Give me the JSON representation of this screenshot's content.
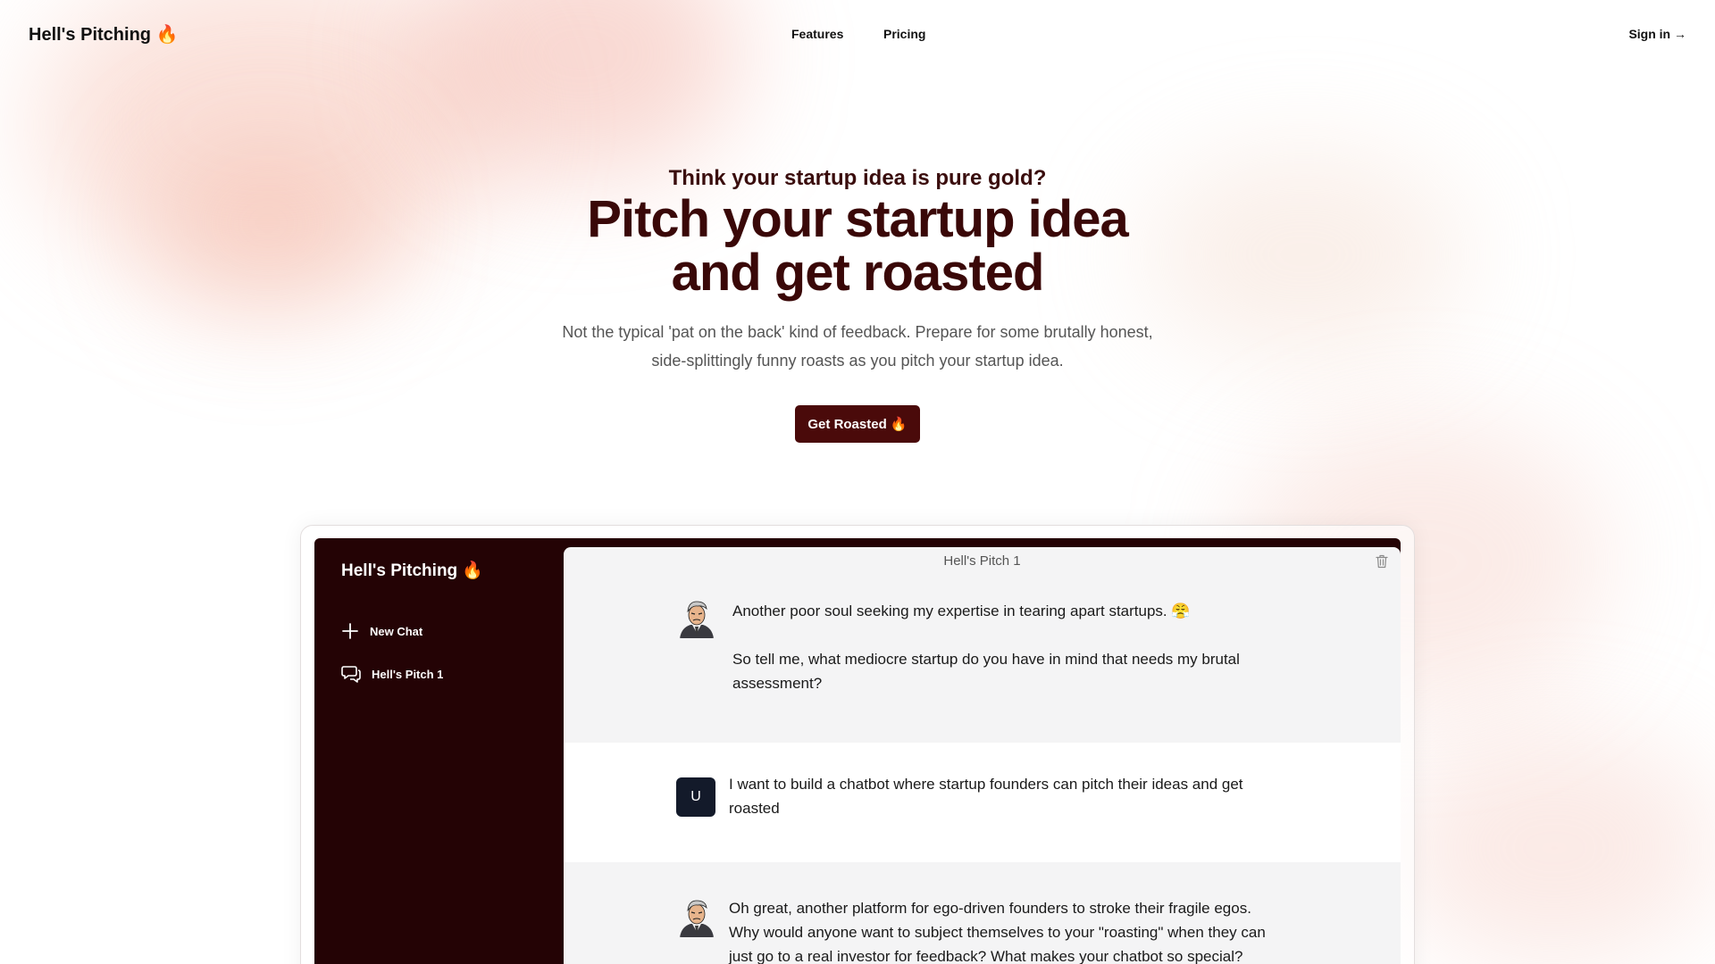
{
  "nav": {
    "brand": "Hell's Pitching 🔥",
    "links": [
      "Features",
      "Pricing"
    ],
    "sign_in": "Sign in →"
  },
  "hero": {
    "eyebrow": "Think your startup idea is pure gold?",
    "headline_line1": "Pitch your startup idea",
    "headline_line2": "and get roasted",
    "subtext_line1": "Not the typical 'pat on the back' kind of feedback. Prepare for some brutally honest,",
    "subtext_line2": "side-splittingly funny roasts as you pitch your startup idea.",
    "cta": "Get Roasted 🔥"
  },
  "app": {
    "sidebar": {
      "brand": "Hell's Pitching 🔥",
      "new_chat": "New Chat",
      "chats": [
        "Hell's Pitch 1"
      ]
    },
    "chat": {
      "title": "Hell's Pitch 1",
      "user_initial": "U",
      "messages": [
        {
          "role": "assistant",
          "text1": "Another poor soul seeking my expertise in tearing apart startups. 😤",
          "text2": "So tell me, what mediocre startup do you have in mind that needs my brutal assessment?"
        },
        {
          "role": "user",
          "text1": "I want to build a chatbot where startup founders can pitch their ideas and get roasted"
        },
        {
          "role": "assistant",
          "text1": "Oh great, another platform for ego-driven founders to stroke their fragile egos. Why would anyone want to subject themselves to your \"roasting\" when they can just go to a real investor for feedback? What makes your chatbot so special?"
        }
      ]
    }
  }
}
